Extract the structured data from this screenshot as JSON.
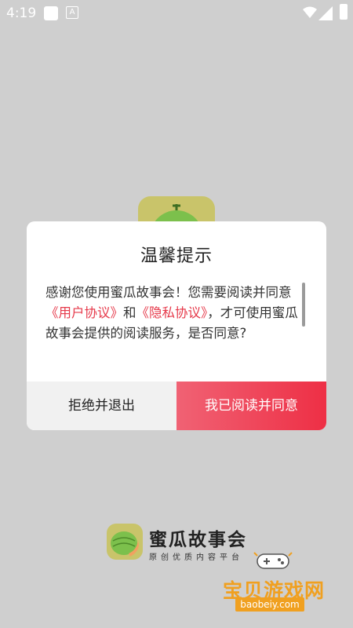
{
  "status_bar": {
    "time": "4:19",
    "a_icon": "A"
  },
  "dialog": {
    "title": "温馨提示",
    "body_part1": "感谢您使用蜜瓜故事会！您需要阅读并同意",
    "link_user": "《用户协议》",
    "body_and": "和",
    "link_privacy": "《隐私协议》",
    "body_part2": "，才可使用蜜瓜故事会提供的阅读服务，是否同意?",
    "decline_label": "拒绝并退出",
    "agree_label": "我已阅读并同意"
  },
  "brand": {
    "name": "蜜瓜故事会",
    "slogan": "原创优质内容平台"
  },
  "watermark": {
    "text": "宝贝游戏网",
    "url": "baobeiy.com"
  },
  "colors": {
    "accent": "#ee2f45",
    "link": "#e6394a",
    "logo_bg": "#c9c46a",
    "watermark": "#f0a020"
  },
  "icons": [
    "wifi-icon",
    "signal-icon",
    "battery-icon",
    "melon-logo-icon",
    "gamepad-icon"
  ]
}
